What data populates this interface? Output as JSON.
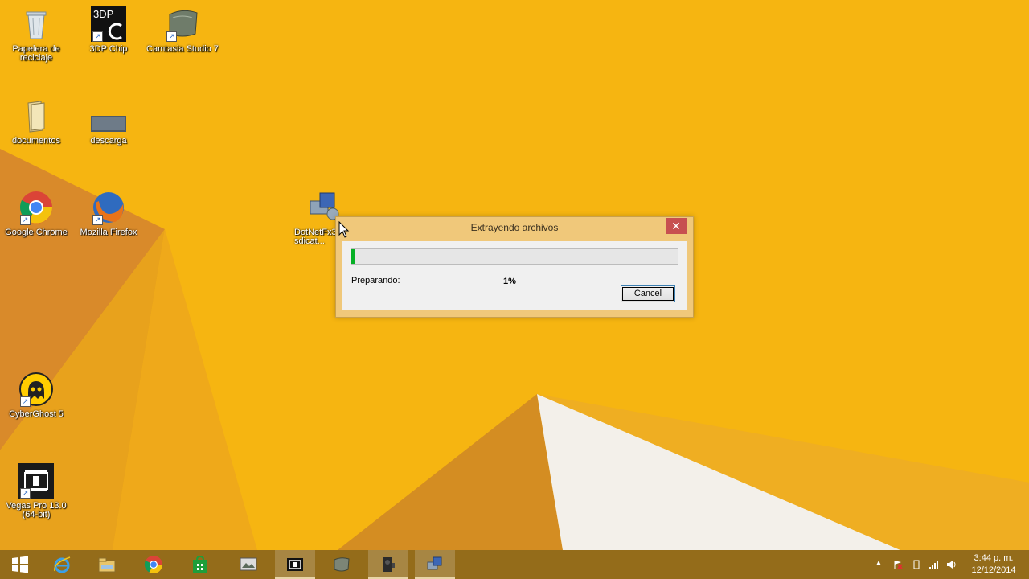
{
  "desktop": {
    "icons": [
      {
        "label": "Papelera de reciclaje",
        "icon": "recycle-bin-icon"
      },
      {
        "label": "3DP Chip",
        "icon": "3dp-chip-icon",
        "glyph_text": "3DP"
      },
      {
        "label": "Camtasia Studio 7",
        "icon": "camtasia-icon"
      },
      {
        "label": "documentos",
        "icon": "folder-icon"
      },
      {
        "label": "descarga",
        "icon": "image-thumbnail-icon"
      },
      {
        "label": "Google Chrome",
        "icon": "chrome-icon"
      },
      {
        "label": "Mozilla Firefox",
        "icon": "firefox-icon"
      },
      {
        "label": "CyberGhost 5",
        "icon": "cyberghost-icon"
      },
      {
        "label": "Vegas Pro 13.0 (64-bit)",
        "icon": "vegas-pro-icon"
      },
      {
        "label": "DotNetFx35 by sdicat...",
        "icon": "installer-icon"
      }
    ]
  },
  "dialog": {
    "title": "Extrayendo archivos",
    "close_label": "✕",
    "status_label": "Preparando:",
    "percent_text": "1%",
    "progress_fraction": 0.01,
    "cancel_label": "Cancel"
  },
  "taskbar": {
    "clock_time": "3:44 p. m.",
    "clock_date": "12/12/2014",
    "items": [
      "start",
      "internet-explorer",
      "file-explorer",
      "chrome",
      "store",
      "camtasia",
      "vegas",
      "app-gray",
      "app-dark",
      "installer-active"
    ]
  },
  "colors": {
    "wallpaper": "#f6b511",
    "progress": "#06b025",
    "dialog_frame": "#f0c87a"
  }
}
